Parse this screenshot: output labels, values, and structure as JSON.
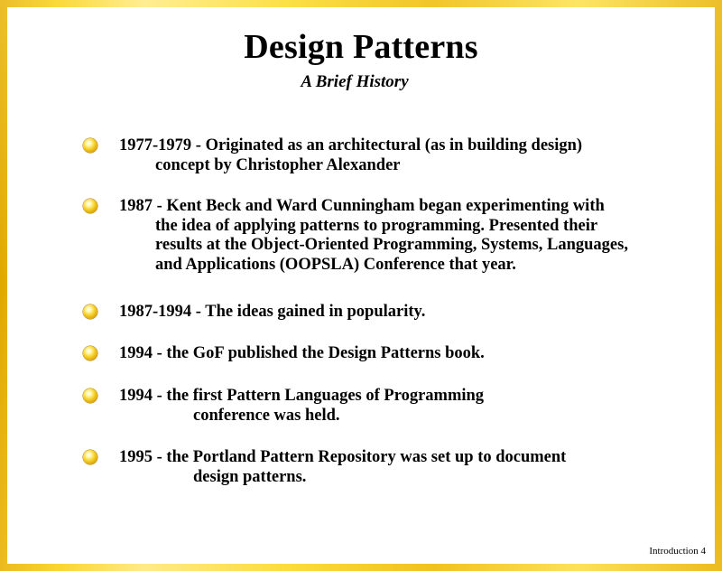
{
  "slide": {
    "title": "Design Patterns",
    "subtitle": "A Brief History",
    "footer": "Introduction 4",
    "bullets": [
      {
        "lines": [
          "1977-1979 - Originated as an architectural (as in building design)",
          "concept by Christopher Alexander"
        ]
      },
      {
        "lines": [
          "1987 - Kent Beck and Ward Cunningham began experimenting with",
          "the idea of applying patterns to programming.  Presented their",
          "results at the Object-Oriented Programming, Systems, Languages,",
          "and Applications (OOPSLA) Conference that year."
        ]
      },
      {
        "lines": [
          "1987-1994 - The ideas gained in popularity."
        ]
      },
      {
        "lines": [
          "1994 - the GoF published the Design Patterns book."
        ]
      },
      {
        "lines": [
          "1994 - the first Pattern Languages of Programming",
          "conference was held."
        ]
      },
      {
        "lines": [
          "1995 - the Portland Pattern Repository was set up to document",
          "design patterns."
        ]
      }
    ]
  },
  "colors": {
    "frame": "#f2c200",
    "background": "#ffffff",
    "text": "#000000"
  },
  "icons": {
    "bullet": "gold-disc-bullet-icon"
  }
}
